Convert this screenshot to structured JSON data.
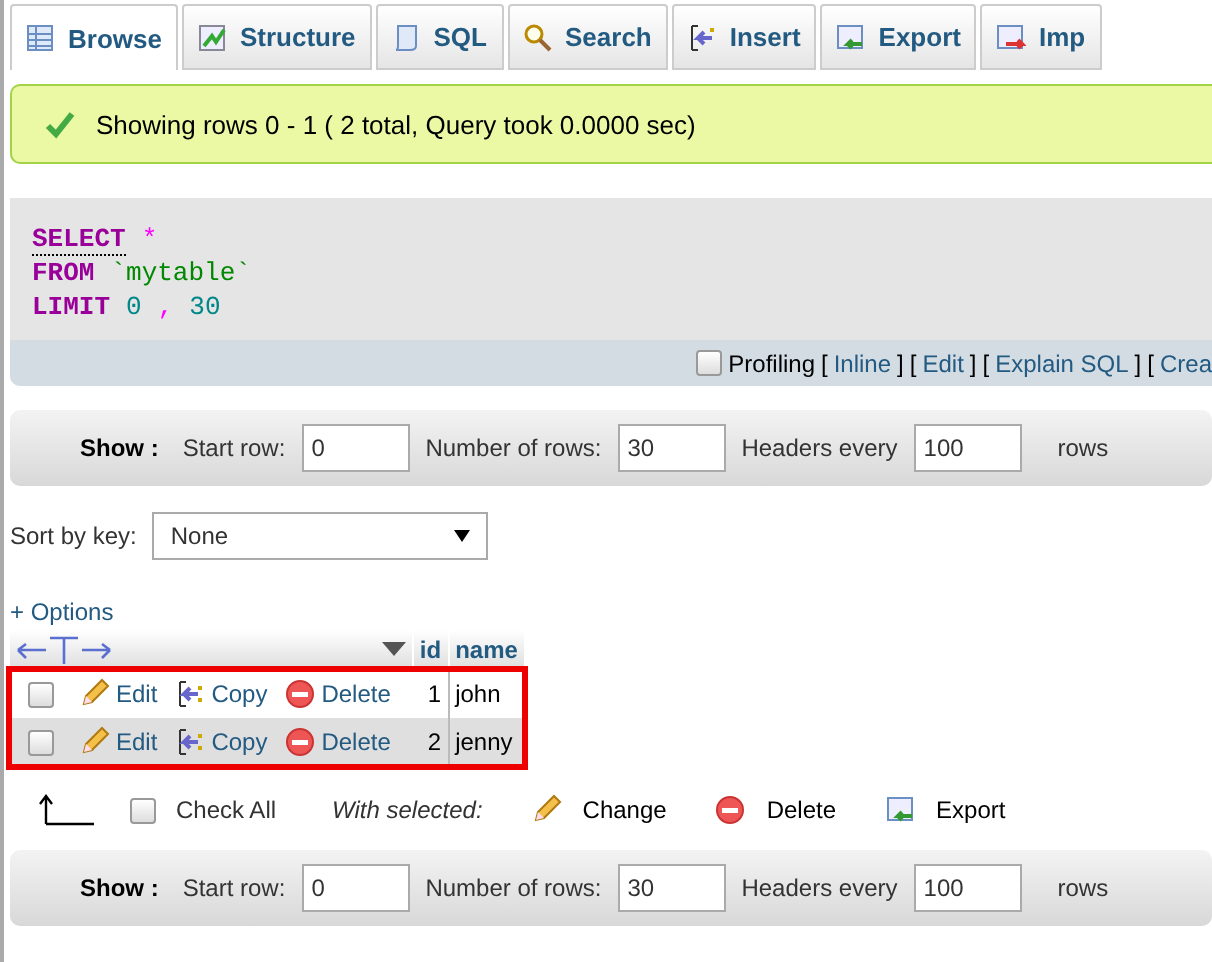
{
  "tabs": [
    {
      "label": "Browse",
      "selected": true
    },
    {
      "label": "Structure",
      "selected": false
    },
    {
      "label": "SQL",
      "selected": false
    },
    {
      "label": "Search",
      "selected": false
    },
    {
      "label": "Insert",
      "selected": false
    },
    {
      "label": "Export",
      "selected": false
    },
    {
      "label": "Imp",
      "selected": false
    }
  ],
  "message": "Showing rows 0 - 1 ( 2 total, Query took 0.0000 sec)",
  "sql": [
    [
      {
        "text": "SELECT",
        "kind": "keyword_link"
      },
      {
        "text": "*",
        "kind": "operator"
      }
    ],
    [
      {
        "text": "FROM",
        "kind": "keyword"
      },
      {
        "text": "`mytable`",
        "kind": "identifier"
      }
    ],
    [
      {
        "text": "LIMIT",
        "kind": "keyword"
      },
      {
        "text": "0",
        "kind": "number"
      },
      {
        "text": ",",
        "kind": "operator"
      },
      {
        "text": "30",
        "kind": "number"
      }
    ]
  ],
  "profiling": {
    "label": "Profiling",
    "checked": false,
    "items": [
      {
        "text": "[",
        "kind": "bracket"
      },
      {
        "text": "Inline",
        "kind": "link"
      },
      {
        "text": "]",
        "kind": "bracket"
      },
      {
        "text": "[",
        "kind": "bracket"
      },
      {
        "text": "Edit",
        "kind": "link"
      },
      {
        "text": "]",
        "kind": "bracket"
      },
      {
        "text": "[",
        "kind": "bracket"
      },
      {
        "text": "Explain SQL",
        "kind": "link"
      },
      {
        "text": "]",
        "kind": "bracket"
      },
      {
        "text": "[",
        "kind": "bracket"
      },
      {
        "text": "Crea",
        "kind": "link"
      }
    ]
  },
  "show_bars": [
    {
      "title": "Show :",
      "start_label": "Start row:",
      "start": "0",
      "rows_label": "Number of rows:",
      "rows": "30",
      "headers_label": "Headers every",
      "headers": "100",
      "suffix": "rows"
    },
    {
      "title": "Show :",
      "start_label": "Start row:",
      "start": "0",
      "rows_label": "Number of rows:",
      "rows": "30",
      "headers_label": "Headers every",
      "headers": "100",
      "suffix": "rows"
    }
  ],
  "sort": {
    "label": "Sort by key:",
    "value": "None"
  },
  "options_link": "+ Options",
  "table": {
    "columns": [
      "id",
      "name"
    ],
    "rows": [
      {
        "checked": false,
        "actions": [
          {
            "label": "Edit",
            "kind": "edit"
          },
          {
            "label": "Copy",
            "kind": "copy"
          },
          {
            "label": "Delete",
            "kind": "delete"
          }
        ],
        "id": "1",
        "name": "john"
      },
      {
        "checked": false,
        "actions": [
          {
            "label": "Edit",
            "kind": "edit"
          },
          {
            "label": "Copy",
            "kind": "copy"
          },
          {
            "label": "Delete",
            "kind": "delete"
          }
        ],
        "id": "2",
        "name": "jenny"
      }
    ]
  },
  "footer": {
    "check_all": {
      "label": "Check All",
      "checked": false
    },
    "with_selected": "With selected:",
    "actions": [
      {
        "label": "Change",
        "kind": "edit"
      },
      {
        "label": "Delete",
        "kind": "delete"
      },
      {
        "label": "Export",
        "kind": "export"
      }
    ]
  }
}
